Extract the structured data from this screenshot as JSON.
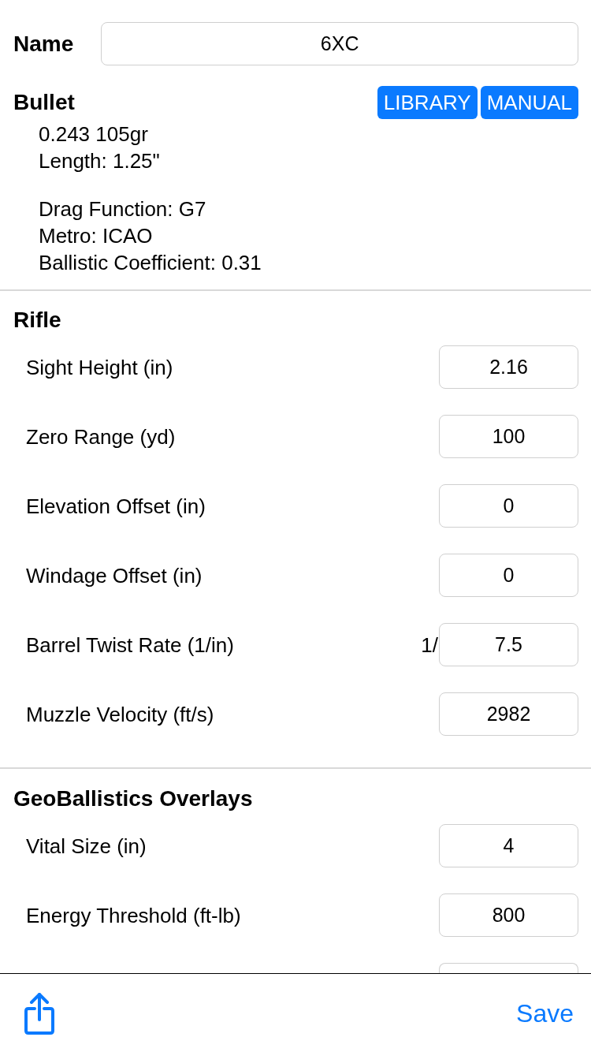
{
  "name": {
    "label": "Name",
    "value": "6XC"
  },
  "bullet": {
    "title": "Bullet",
    "buttons": [
      "LIBRARY",
      "MANUAL"
    ],
    "detail_groups": [
      {
        "lines": [
          "0.243 105gr",
          "Length: 1.25\""
        ]
      },
      {
        "lines": [
          "Drag Function: G7",
          "Metro: ICAO",
          "Ballistic Coefficient: 0.31"
        ]
      }
    ]
  },
  "sections": [
    {
      "title": "Rifle",
      "rows": [
        {
          "kind": "field",
          "label": "Sight Height (in)",
          "value": "2.16"
        },
        {
          "kind": "field",
          "label": "Zero Range (yd)",
          "value": "100"
        },
        {
          "kind": "field",
          "label": "Elevation Offset (in)",
          "value": "0"
        },
        {
          "kind": "field",
          "label": "Windage Offset (in)",
          "value": "0"
        },
        {
          "kind": "field",
          "label": "Barrel Twist Rate (1/in)",
          "prefix": "1/",
          "value": "7.5"
        },
        {
          "kind": "field",
          "label": "Muzzle Velocity (ft/s)",
          "value": "2982"
        }
      ]
    },
    {
      "title": "GeoBallistics Overlays",
      "rows": [
        {
          "kind": "field",
          "label": "Vital Size (in)",
          "value": "4"
        },
        {
          "kind": "field",
          "label": "Energy Threshold (ft-lb)",
          "value": "800"
        },
        {
          "kind": "cut"
        }
      ]
    }
  ],
  "toolbar": {
    "save": "Save"
  }
}
